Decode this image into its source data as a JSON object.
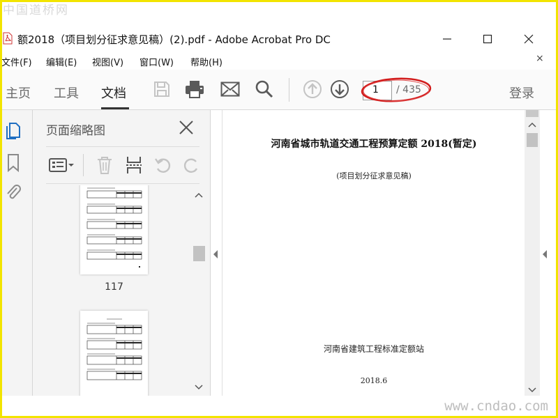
{
  "watermarks": {
    "top": "中国道桥网",
    "bottom": "www.cndao.com"
  },
  "window": {
    "title": "额2018（项目划分征求意见稿）(2).pdf - Adobe Acrobat Pro DC"
  },
  "menu": {
    "items": [
      "文件(F)",
      "编辑(E)",
      "视图(V)",
      "窗口(W)",
      "帮助(H)"
    ],
    "close": "×"
  },
  "toolbar": {
    "tabs": [
      "主页",
      "工具",
      "文档"
    ],
    "active_tab": "文档",
    "page_current": "1",
    "page_total": "/ 435",
    "login": "登录"
  },
  "panel": {
    "title": "页面缩略图",
    "thumbnail_page_label": "117"
  },
  "document": {
    "title": "河南省城市轨道交通工程预算定额 2018(暂定)",
    "subtitle": "(项目划分征求意见稿)",
    "organization": "河南省建筑工程标准定额站",
    "date": "2018.6"
  },
  "colors": {
    "frame": "#f2e400",
    "annotation": "#d21c1c",
    "sidebar_active": "#1f6fc2"
  }
}
